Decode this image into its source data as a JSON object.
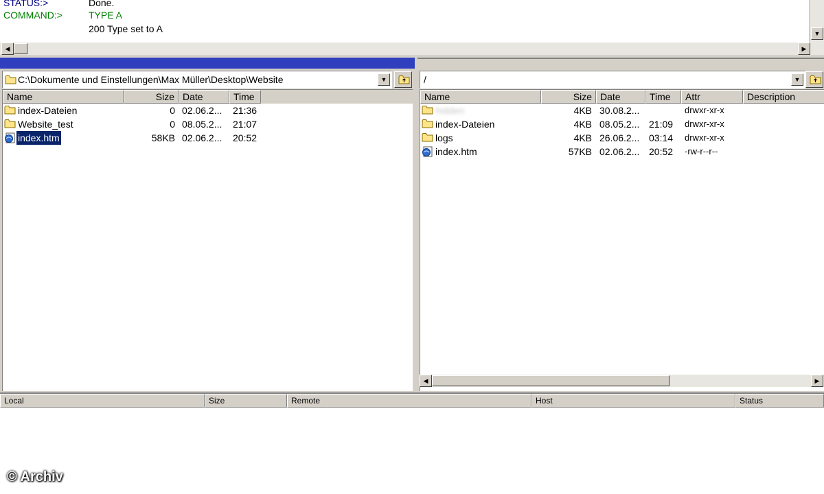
{
  "log": {
    "lines": [
      {
        "label": "STATUS:>",
        "text": "Done.",
        "kind": "status"
      },
      {
        "label": "COMMAND:>",
        "text": "TYPE A",
        "kind": "command"
      },
      {
        "label": "",
        "text": "200 Type set to A",
        "kind": "response"
      }
    ]
  },
  "local": {
    "path": "C:\\Dokumente und Einstellungen\\Max Müller\\Desktop\\Website",
    "columns": {
      "name": "Name",
      "size": "Size",
      "date": "Date",
      "time": "Time"
    },
    "files": [
      {
        "name": "index-Dateien",
        "size": "0",
        "date": "02.06.2...",
        "time": "21:36",
        "type": "folder"
      },
      {
        "name": "Website_test",
        "size": "0",
        "date": "08.05.2...",
        "time": "21:07",
        "type": "folder"
      },
      {
        "name": "index.htm",
        "size": "58KB",
        "date": "02.06.2...",
        "time": "20:52",
        "type": "html",
        "selected": true
      }
    ]
  },
  "remote": {
    "path": "/",
    "columns": {
      "name": "Name",
      "size": "Size",
      "date": "Date",
      "time": "Time",
      "attr": "Attr",
      "description": "Description"
    },
    "files": [
      {
        "name": "hidden",
        "size": "4KB",
        "date": "30.08.2...",
        "time": "",
        "attr": "drwxr-xr-x",
        "type": "folder",
        "blurred": true
      },
      {
        "name": "index-Dateien",
        "size": "4KB",
        "date": "08.05.2...",
        "time": "21:09",
        "attr": "drwxr-xr-x",
        "type": "folder"
      },
      {
        "name": "logs",
        "size": "4KB",
        "date": "26.06.2...",
        "time": "03:14",
        "attr": "drwxr-xr-x",
        "type": "folder"
      },
      {
        "name": "index.htm",
        "size": "57KB",
        "date": "02.06.2...",
        "time": "20:52",
        "attr": "-rw-r--r--",
        "type": "html"
      }
    ]
  },
  "queue": {
    "columns": {
      "local": "Local",
      "size": "Size",
      "remote": "Remote",
      "host": "Host",
      "status": "Status"
    }
  },
  "watermark": "© Archiv",
  "colors": {
    "selection": "#0a246a",
    "active_title": "#2f3fbd",
    "status_label": "#000080",
    "command_text": "#008000"
  }
}
